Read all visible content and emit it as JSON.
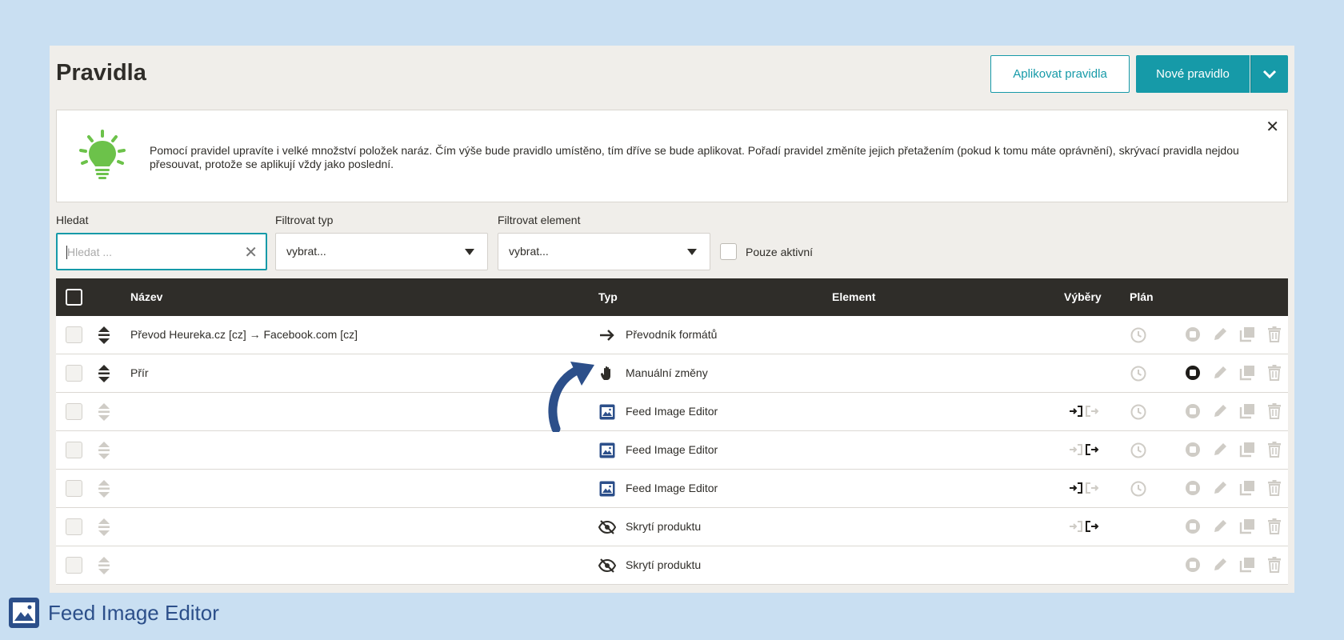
{
  "header": {
    "title": "Pravidla",
    "apply_label": "Aplikovat pravidla",
    "new_label": "Nové pravidlo"
  },
  "info": {
    "text": "Pomocí pravidel upravíte i velké množství položek naráz. Čím výše bude pravidlo umístěno, tím dříve se bude aplikovat. Pořadí pravidel změníte jejich přetažením (pokud k tomu máte oprávnění), skrývací pravidla nejdou přesouvat, protože se aplikují vždy jako poslední."
  },
  "filters": {
    "search_label": "Hledat",
    "search_placeholder": "Hledat ...",
    "type_label": "Filtrovat typ",
    "type_value": "vybrat...",
    "element_label": "Filtrovat element",
    "element_value": "vybrat...",
    "active_only_label": "Pouze aktivní"
  },
  "table": {
    "columns": {
      "name": "Název",
      "type": "Typ",
      "element": "Element",
      "selections": "Výběry",
      "plan": "Plán"
    },
    "rows": [
      {
        "name": "Převod Heureka.cz [cz] → Facebook.com [cz]",
        "type": "Převodník formátů",
        "type_icon": "arrow-right-icon",
        "selections": "",
        "active_stop": false,
        "dimmed_drag": false,
        "has_plan": true
      },
      {
        "name": "Přír",
        "type": "Manuální změny",
        "type_icon": "hand-icon",
        "selections": "",
        "active_stop": true,
        "dimmed_drag": false,
        "has_plan": true
      },
      {
        "name": "",
        "type": "Feed Image Editor",
        "type_icon": "image-editor-icon",
        "selections": "in",
        "active_stop": false,
        "dimmed_drag": true,
        "has_plan": true
      },
      {
        "name": "",
        "type": "Feed Image Editor",
        "type_icon": "image-editor-icon",
        "selections": "out",
        "active_stop": false,
        "dimmed_drag": true,
        "has_plan": true
      },
      {
        "name": "",
        "type": "Feed Image Editor",
        "type_icon": "image-editor-icon",
        "selections": "in",
        "active_stop": false,
        "dimmed_drag": true,
        "has_plan": true
      },
      {
        "name": "",
        "type": "Skrytí produktu",
        "type_icon": "eye-off-icon",
        "selections": "out",
        "active_stop": false,
        "dimmed_drag": true,
        "has_plan": false
      },
      {
        "name": "",
        "type": "Skrytí produktu",
        "type_icon": "eye-off-icon",
        "selections": "",
        "active_stop": false,
        "dimmed_drag": true,
        "has_plan": false
      }
    ]
  },
  "caption": {
    "text": "Feed Image Editor"
  },
  "colors": {
    "accent": "#169aa8",
    "header_bg": "#2f2d29",
    "bulb": "#6cc24a",
    "caption": "#2c4f8a"
  }
}
